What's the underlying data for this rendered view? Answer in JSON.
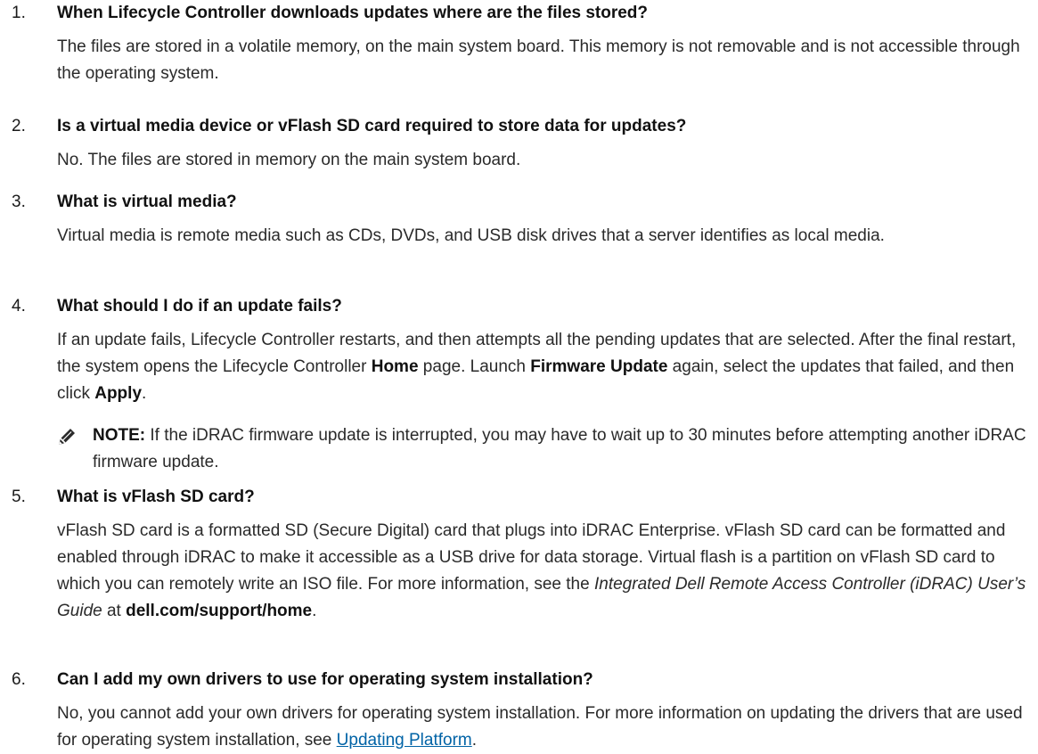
{
  "faq": [
    {
      "number": "1.",
      "question": "When Lifecycle Controller downloads updates where are the files stored?",
      "answer": "The files are stored in a volatile memory, on the main system board. This memory is not removable and is not accessible through the operating system."
    },
    {
      "number": "2.",
      "question": "Is a virtual media device or vFlash SD card required to store data for updates?",
      "answer": "No. The files are stored in memory on the main system board."
    },
    {
      "number": "3.",
      "question": "What is virtual media?",
      "answer": "Virtual media is remote media such as CDs, DVDs, and USB disk drives that a server identifies as local media."
    },
    {
      "number": "4.",
      "question": "What should I do if an update fails?",
      "answer_part1": "If an update fails, Lifecycle Controller restarts, and then attempts all the pending updates that are selected. After the final restart, the system opens the Lifecycle Controller ",
      "answer_bold1": "Home",
      "answer_part2": " page. Launch ",
      "answer_bold2": "Firmware Update",
      "answer_part3": " again, select the updates that failed, and then click ",
      "answer_bold3": "Apply",
      "answer_part4": ".",
      "note_label": "NOTE:",
      "note_text": " If the iDRAC firmware update is interrupted, you may have to wait up to 30 minutes before attempting another iDRAC firmware update.",
      "note_icon": "pencil-note-icon"
    },
    {
      "number": "5.",
      "question": "What is vFlash SD card?",
      "answer_part1": "vFlash SD card is a formatted SD (Secure Digital) card that plugs into iDRAC Enterprise. vFlash SD card can be formatted and enabled through iDRAC to make it accessible as a USB drive for data storage. Virtual flash is a partition on vFlash SD card to which you can remotely write an ISO file. For more information, see the ",
      "answer_italic": "Integrated Dell Remote Access Controller (iDRAC) User’s Guide",
      "answer_part2": " at ",
      "answer_bold": "dell.com/support/home",
      "answer_part3": "."
    },
    {
      "number": "6.",
      "question": "Can I add my own drivers to use for operating system installation?",
      "answer_part1": "No, you cannot add your own drivers for operating system installation. For more information on updating the drivers that are used for operating system installation, see ",
      "answer_link": "Updating Platform",
      "answer_part2": "."
    }
  ],
  "colors": {
    "link": "#0063a6",
    "text": "#2a2a2a",
    "heading": "#111111"
  }
}
